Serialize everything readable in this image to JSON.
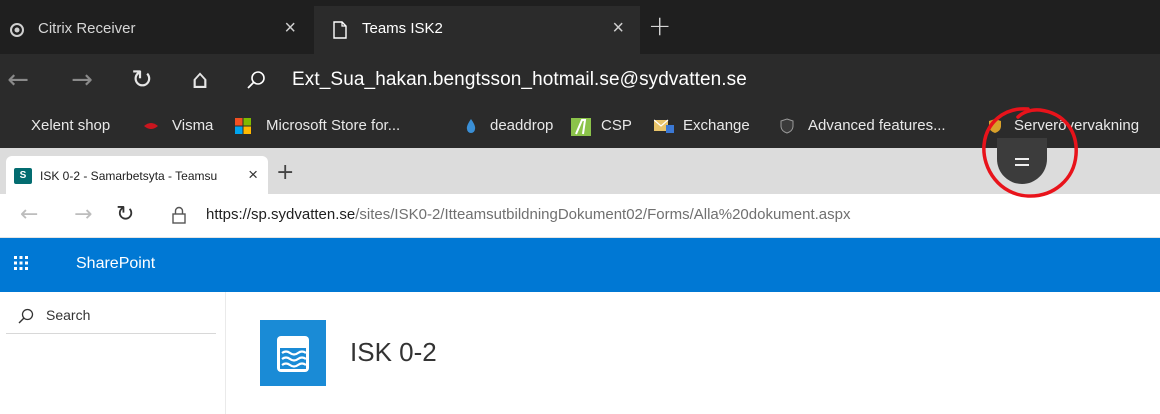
{
  "outer_browser": {
    "tabs": [
      {
        "title": "Citrix Receiver",
        "close": "×",
        "active": false
      },
      {
        "title": "Teams ISK2",
        "close": "×",
        "active": true
      }
    ],
    "new_tab": "+",
    "nav": {
      "back": "←",
      "forward": "→",
      "refresh": "↻",
      "home": "⌂"
    },
    "address": "Ext_Sua_hakan.bengtsson_hotmail.se@sydvatten.se",
    "favorites": [
      {
        "label": "Xelent shop"
      },
      {
        "label": "Visma"
      },
      {
        "label": "Microsoft Store for..."
      },
      {
        "label": "deaddrop"
      },
      {
        "label": "CSP"
      },
      {
        "label": "Exchange"
      },
      {
        "label": "Advanced features..."
      },
      {
        "label": "Serverövervakning"
      }
    ]
  },
  "inner_browser": {
    "tab": {
      "favicon": "S",
      "title": "ISK 0-2 - Samarbetsyta - Teamsu",
      "close": "×"
    },
    "new_tab": "+",
    "nav": {
      "back": "←",
      "forward": "→",
      "refresh": "↻"
    },
    "url_host": "https://sp.sydvatten.se",
    "url_path": "/sites/ISK0-2/ItteamsutbildningDokument02/Forms/Alla%20dokument.aspx"
  },
  "sharepoint": {
    "brand": "SharePoint",
    "search_label": "Search",
    "site_title": "ISK 0-2"
  },
  "colors": {
    "sharepoint_blue": "#0078d4",
    "annotation_red": "#e8131b",
    "outer_dark": "#2b2b2b"
  }
}
